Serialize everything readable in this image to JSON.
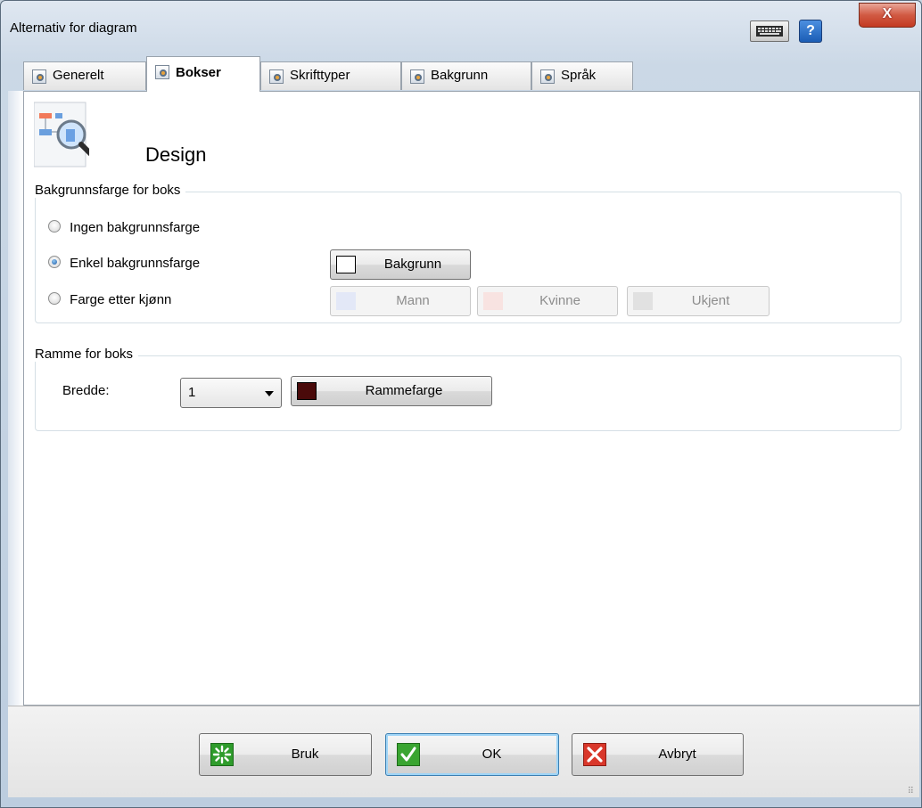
{
  "window": {
    "title": "Alternativ for diagram"
  },
  "titlebar": {
    "help_label": "?",
    "close_label": "X"
  },
  "tabs": [
    {
      "label": "Generelt",
      "active": false
    },
    {
      "label": "Bokser",
      "active": true
    },
    {
      "label": "Skrifttyper",
      "active": false
    },
    {
      "label": "Bakgrunn",
      "active": false
    },
    {
      "label": "Språk",
      "active": false
    }
  ],
  "section": {
    "title": "Design"
  },
  "background_group": {
    "title": "Bakgrunnsfarge for boks",
    "options": [
      {
        "label": "Ingen bakgrunnsfarge",
        "checked": false
      },
      {
        "label": "Enkel bakgrunnsfarge",
        "checked": true
      },
      {
        "label": "Farge etter kjønn",
        "checked": false
      }
    ],
    "background_button": {
      "label": "Bakgrunn",
      "color": "#ffffff"
    },
    "gender_buttons": [
      {
        "label": "Mann",
        "color": "#e3e8f7"
      },
      {
        "label": "Kvinne",
        "color": "#f8e3e1"
      },
      {
        "label": "Ukjent",
        "color": "#e1e1e1"
      }
    ]
  },
  "frame_group": {
    "title": "Ramme for boks",
    "width_label": "Bredde:",
    "width_value": "1",
    "frame_color_button": {
      "label": "Rammefarge",
      "color": "#4a0a0a"
    }
  },
  "footer": {
    "apply_label": "Bruk",
    "ok_label": "OK",
    "cancel_label": "Avbryt"
  },
  "colors": {
    "ok_icon": "#3aa531",
    "cancel_icon": "#d9372a",
    "apply_icon": "#2f9c2c"
  }
}
